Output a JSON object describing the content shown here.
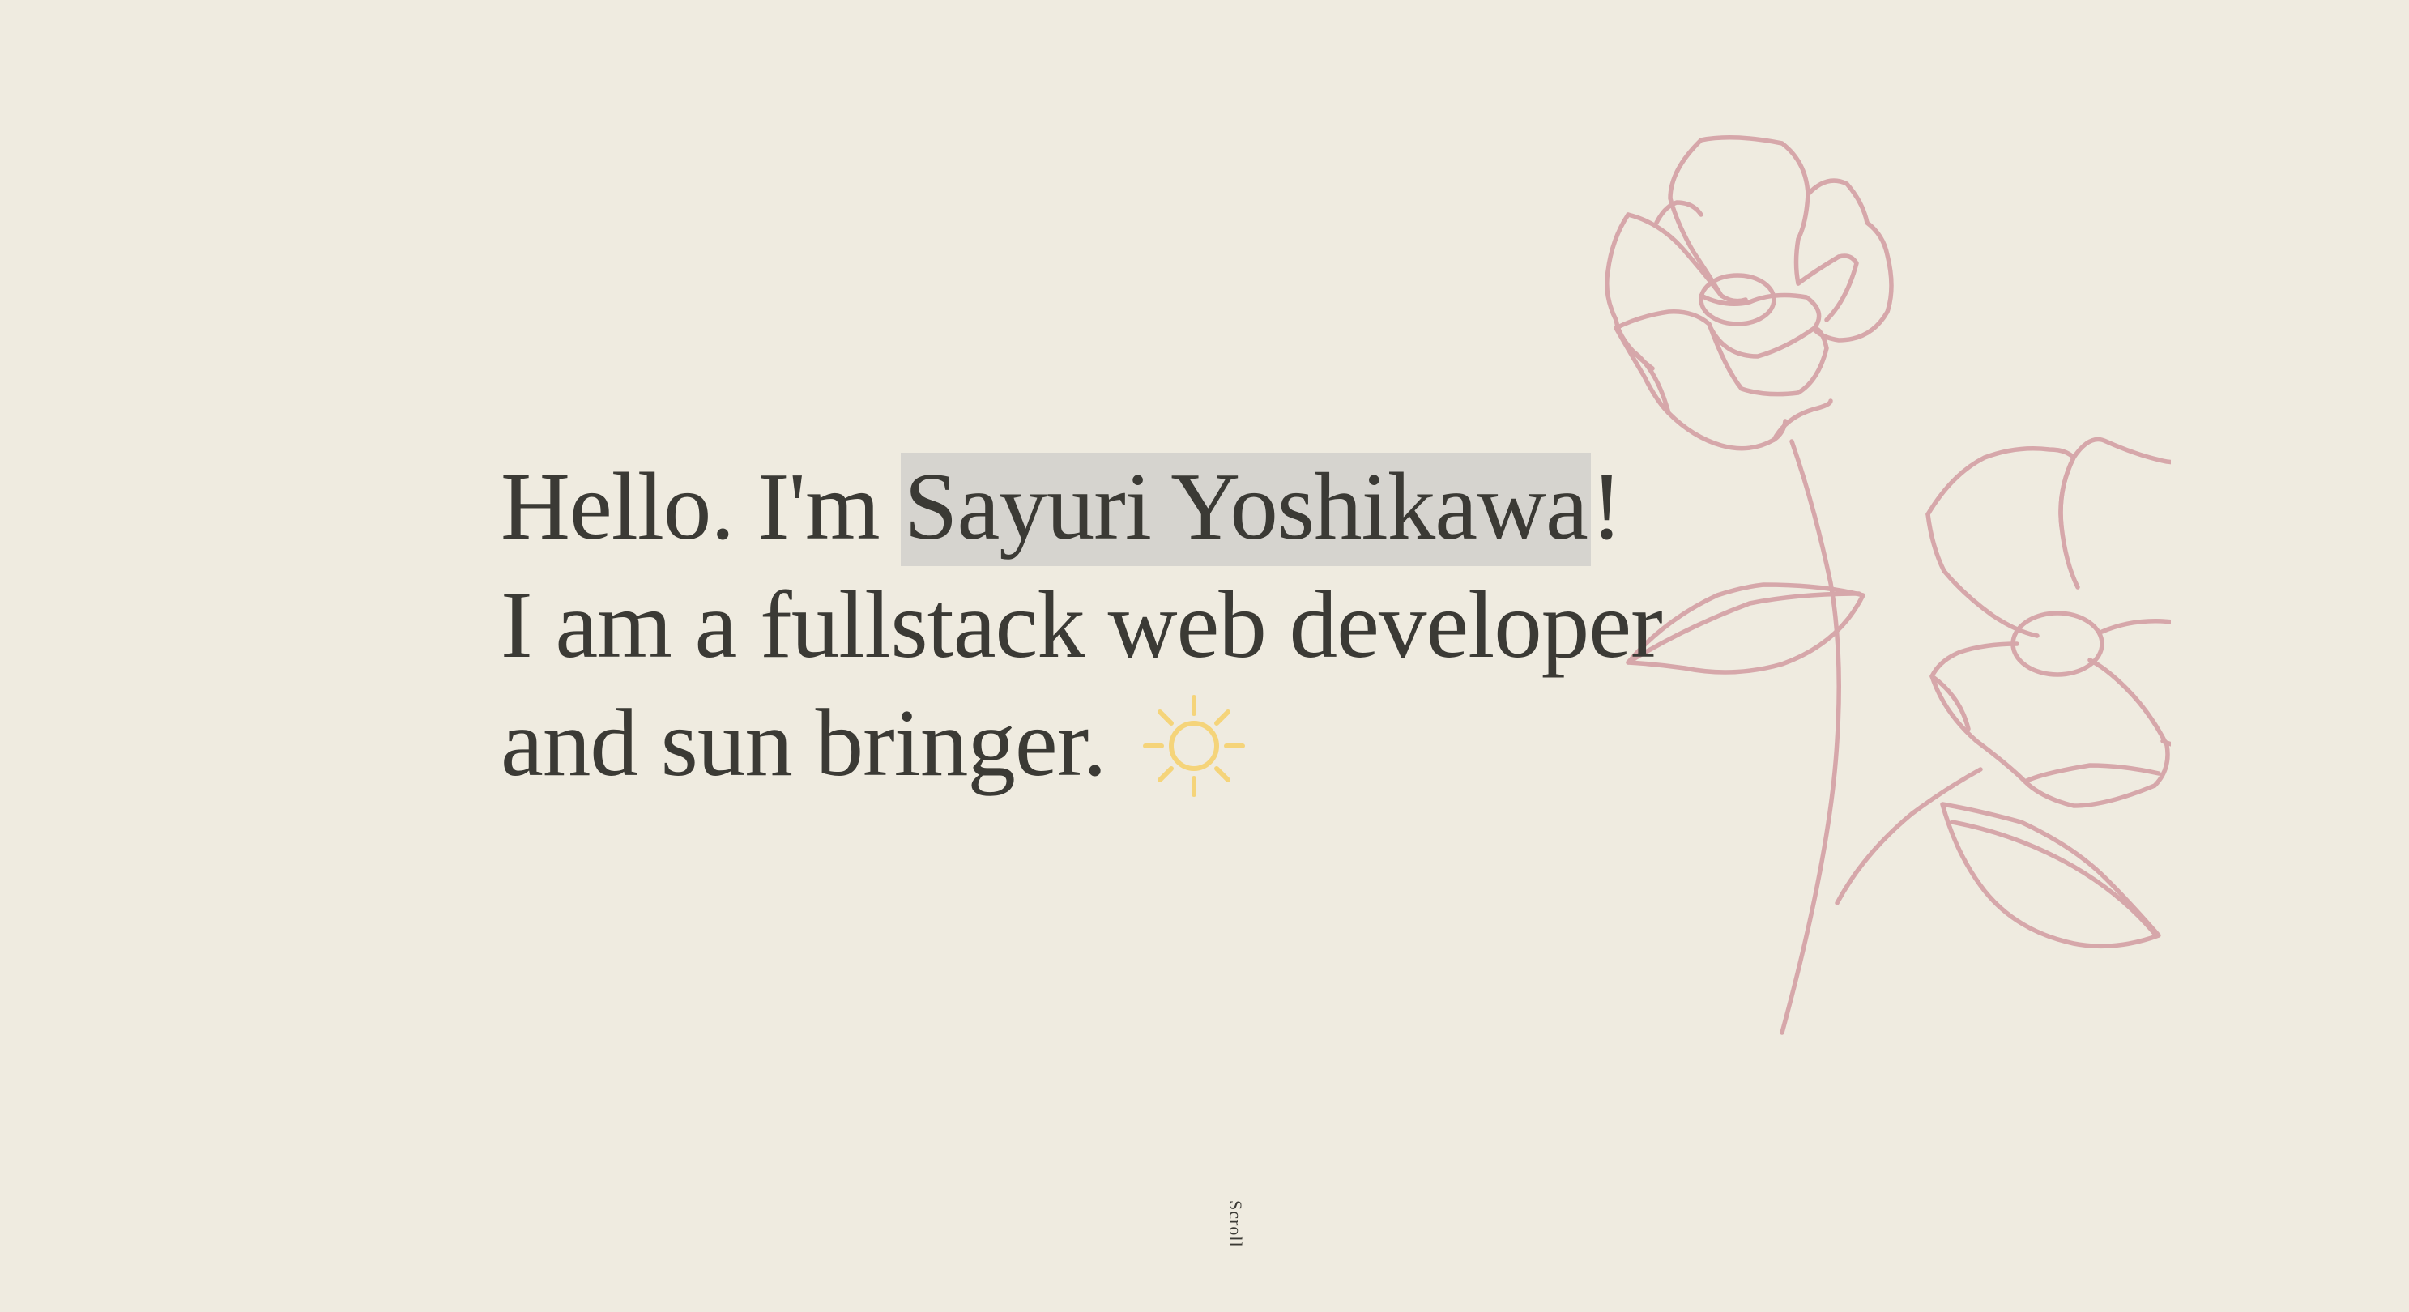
{
  "hero": {
    "greeting": "Hello. I'm",
    "name": "Sayuri Yoshikawa",
    "exclamation": "!",
    "line2": "I am a fullstack web developer",
    "line3": "and sun bringer."
  },
  "scroll_label": "Scroll",
  "icons": {
    "sun": "sun-icon",
    "illustration": "flower-illustration"
  },
  "colors": {
    "background": "#efebe0",
    "text": "#3b3a35",
    "highlight": "#d6d4cf",
    "flower_stroke": "#d6a7aa",
    "sun": "#f5d47a"
  }
}
